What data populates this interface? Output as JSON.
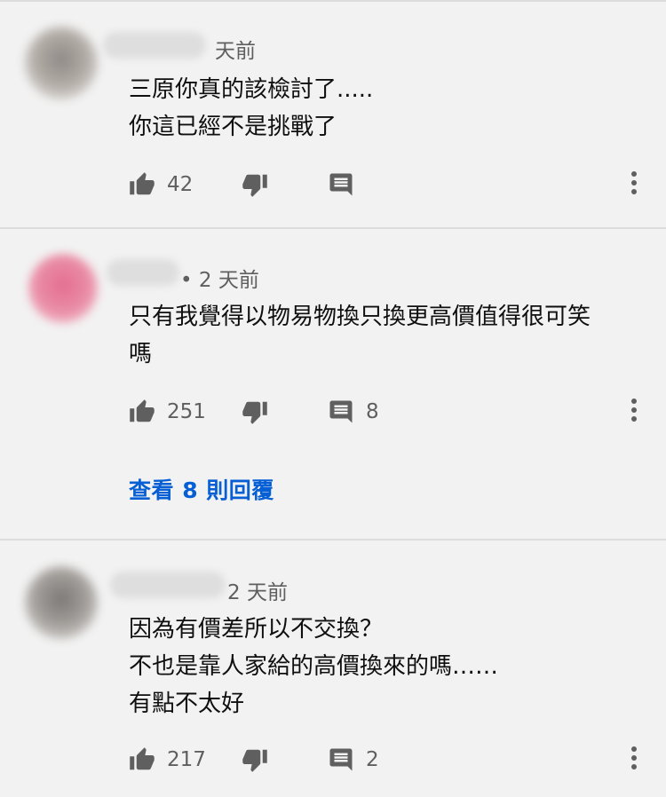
{
  "comments": [
    {
      "time": "天前",
      "lines": [
        "三原你真的該檢討了.....",
        "你這已經不是挑戰了"
      ],
      "likes": "42",
      "replies": ""
    },
    {
      "time": "• 2 天前",
      "lines": [
        "只有我覺得以物易物換只換更高價值得很可笑",
        "嗎"
      ],
      "likes": "251",
      "replies": "8",
      "view_replies": "查看 8 則回覆"
    },
    {
      "time": "2 天前",
      "lines": [
        "因為有價差所以不交換？",
        "不也是靠人家給的高價換來的嗎……",
        "有點不太好"
      ],
      "likes": "217",
      "replies": "2"
    }
  ],
  "icons": {
    "like": "thumbs-up-icon",
    "dislike": "thumbs-down-icon",
    "reply": "comment-reply-icon",
    "more": "more-vertical-icon"
  },
  "colors": {
    "background": "#f2f2f2",
    "link": "#065fd4",
    "secondary_text": "#5f5f5f",
    "icon": "#5f5f5f"
  }
}
